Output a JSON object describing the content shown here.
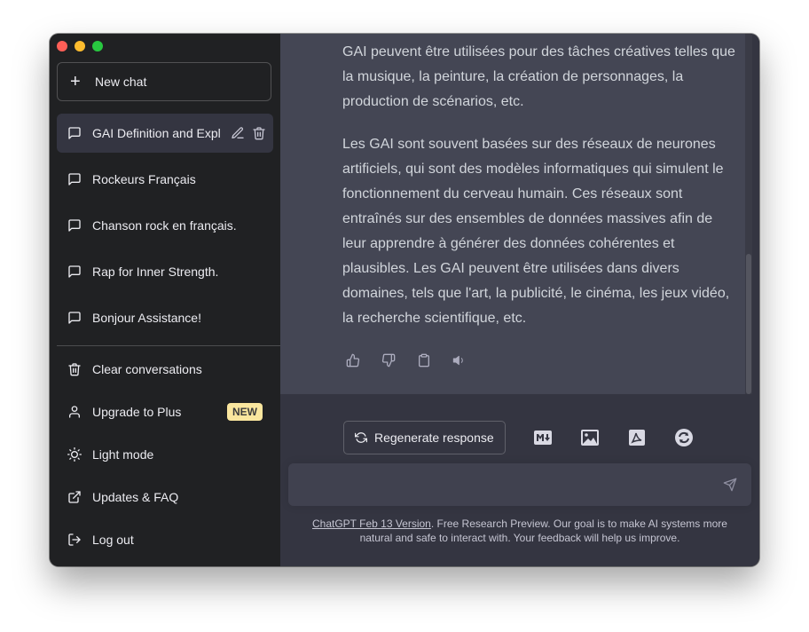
{
  "sidebar": {
    "new_chat_label": "New chat",
    "conversations": [
      {
        "label": "GAI Definition and Expl"
      },
      {
        "label": "Rockeurs Français"
      },
      {
        "label": "Chanson rock en français."
      },
      {
        "label": "Rap for Inner Strength."
      },
      {
        "label": "Bonjour Assistance!"
      }
    ],
    "menu": [
      {
        "label": "Clear conversations",
        "icon": "trash-icon"
      },
      {
        "label": "Upgrade to Plus",
        "icon": "user-icon",
        "badge": "NEW"
      },
      {
        "label": "Light mode",
        "icon": "sun-icon"
      },
      {
        "label": "Updates & FAQ",
        "icon": "external-link-icon"
      },
      {
        "label": "Log out",
        "icon": "logout-icon"
      }
    ]
  },
  "message": {
    "paragraphs": [
      "GAI peuvent être utilisées pour des tâches créatives telles que la musique, la peinture, la création de personnages, la production de scénarios, etc.",
      "Les GAI sont souvent basées sur des réseaux de neurones artificiels, qui sont des modèles informatiques qui simulent le fonctionnement du cerveau humain. Ces réseaux sont entraînés sur des ensembles de données massives afin de leur apprendre à générer des données cohérentes et plausibles. Les GAI peuvent être utilisées dans divers domaines, tels que l'art, la publicité, le cinéma, les jeux vidéo, la recherche scientifique, etc."
    ]
  },
  "toolbar": {
    "regenerate_label": "Regenerate response"
  },
  "input": {
    "value": "",
    "placeholder": ""
  },
  "footer": {
    "link_text": "ChatGPT Feb 13 Version",
    "text": ". Free Research Preview. Our goal is to make AI systems more natural and safe to interact with. Your feedback will help us improve."
  },
  "colors": {
    "sidebar_bg": "#202123",
    "main_bg": "#343541",
    "message_bg": "#444654",
    "badge_bg": "#fae69e"
  }
}
